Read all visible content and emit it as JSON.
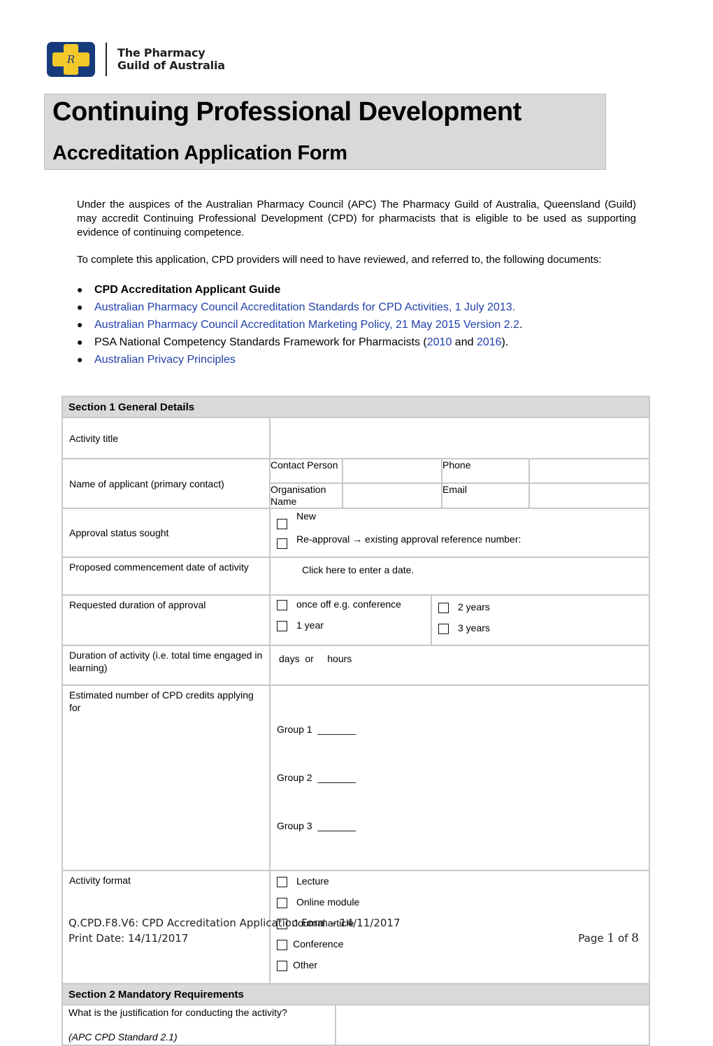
{
  "logo": {
    "mark_letter": "R",
    "line1": "The Pharmacy",
    "line2": "Guild of Australia"
  },
  "title": {
    "main": "Continuing Professional Development",
    "sub": "Accreditation Application Form"
  },
  "intro": {
    "paragraph1": "Under the auspices of the Australian Pharmacy Council (APC) The Pharmacy Guild of Australia, Queensland (Guild) may accredit Continuing Professional Development (CPD) for pharmacists that is eligible to be used as supporting evidence of continuing competence.",
    "paragraph2": "To complete this application, CPD providers will need to have reviewed, and referred to, the following documents:",
    "bullet_char": "●",
    "documents": [
      {
        "text": "CPD Accreditation Applicant Guide"
      },
      {
        "text": "Australian Pharmacy Council Accreditation Standards for CPD Activities, 1 July 2013."
      },
      {
        "text": "Australian Pharmacy Council Accreditation Marketing Policy, 21 May 2015 Version 2.2",
        "suffix": "."
      },
      {
        "prefix": "PSA National Competency Standards Framework for Pharmacists (",
        "link1": "2010",
        "mid": " and ",
        "link2": "2016",
        "suffix": ")."
      },
      {
        "text": "Australian Privacy Principles"
      }
    ]
  },
  "section1": {
    "header": "Section 1 General Details",
    "activity_title": {
      "label": "Activity title",
      "value": ""
    },
    "applicant": {
      "label": "Name of applicant (primary contact)",
      "contact_person_label": "Contact Person",
      "organisation_label": "Organisation Name",
      "phone_label": "Phone",
      "email_label": "Email",
      "contact_person_value": "",
      "organisation_value": "",
      "phone_value": "",
      "email_value": ""
    },
    "approval_status": {
      "label": "Approval status sought",
      "options": [
        "New",
        "Re-approval  → existing approval reference number:"
      ]
    },
    "commencement": {
      "label": "Proposed commencement date of activity",
      "placeholder": "Click here to enter a date."
    },
    "requested_duration": {
      "label": "Requested duration of approval",
      "options": [
        "once off e.g. conference",
        "1 year",
        "2 years",
        "3 years"
      ]
    },
    "activity_duration": {
      "label": "Duration of activity (i.e. total time engaged in learning)",
      "value": "days  or     hours"
    },
    "credits": {
      "label": "Estimated number of CPD credits applying for",
      "groups": [
        "Group 1  _______",
        "Group 2  _______",
        "Group 3  _______"
      ]
    },
    "format": {
      "label": "Activity format",
      "options": [
        "Lecture",
        "Online module",
        "Journal article",
        "Conference",
        "Other"
      ]
    }
  },
  "section2": {
    "header": "Section 2 Mandatory Requirements",
    "justification_label": "What is the justification for conducting the activity?",
    "justification_ref": "(APC CPD Standard 2.1)",
    "justification_value": ""
  },
  "footer": {
    "doc_id": "Q.CPD.F8.V6: CPD Accreditation Application Form – 14/11/2017",
    "print_date": "Print Date:  14/11/2017",
    "page_label": "Page ",
    "page_current": "1",
    "page_of": " of ",
    "page_total": "8"
  }
}
